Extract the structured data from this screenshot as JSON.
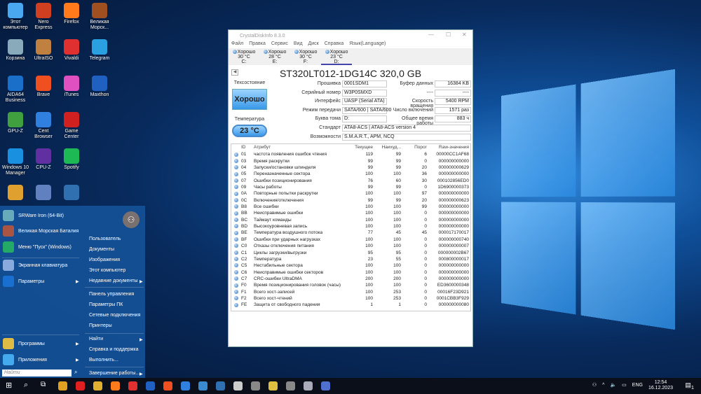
{
  "desktop": {
    "icons": [
      {
        "label": "Этот компьютер",
        "color": "#4aa8f0"
      },
      {
        "label": "Nero Express",
        "color": "#d04020"
      },
      {
        "label": "Firefox",
        "color": "#ff7a1a"
      },
      {
        "label": "Великая Морск...",
        "color": "#a05020"
      },
      {
        "label": "Корзина",
        "color": "#8ab"
      },
      {
        "label": "UltraISO",
        "color": "#c08040"
      },
      {
        "label": "Vivaldi",
        "color": "#e03030"
      },
      {
        "label": "Telegram",
        "color": "#2aa0e0"
      },
      {
        "label": "AIDA64 Business",
        "color": "#1a70c8"
      },
      {
        "label": "Brave",
        "color": "#f05020"
      },
      {
        "label": "iTunes",
        "color": "#e050c0"
      },
      {
        "label": "Maxthon",
        "color": "#2060c0"
      },
      {
        "label": "GPU-Z",
        "color": "#40a040"
      },
      {
        "label": "Cent Browser",
        "color": "#3080e0"
      },
      {
        "label": "Game Center",
        "color": "#d02020"
      },
      null,
      {
        "label": "Windows 10 Manager",
        "color": "#1a90e0"
      },
      {
        "label": "CPU-Z",
        "color": "#6030a0"
      },
      {
        "label": "Spotify",
        "color": "#1db954"
      },
      null,
      {
        "label": "",
        "color": "#e0a030"
      },
      {
        "label": "",
        "color": "#6080c0"
      },
      {
        "label": "",
        "color": "#3070b0"
      },
      null
    ]
  },
  "window": {
    "title": "CrystalDiskInfo 8.3.0",
    "menu": [
      "Файл",
      "Правка",
      "Сервис",
      "Вид",
      "Диск",
      "Справка",
      "Язык(Language)"
    ],
    "drives": [
      {
        "status": "Хорошо",
        "temp": "30 °C",
        "letter": "C:"
      },
      {
        "status": "Хорошо",
        "temp": "28 °C",
        "letter": "E:"
      },
      {
        "status": "Хорошо",
        "temp": "30 °C",
        "letter": "F:"
      },
      {
        "status": "Хорошо",
        "temp": "23 °C",
        "letter": "D:"
      }
    ],
    "model": "ST320LT012-1DG14C 320,0 GB",
    "health_label": "Техсостояние",
    "health": "Хорошо",
    "temp_label": "Температура",
    "temp": "23 °C",
    "fields": [
      {
        "label": "Прошивка",
        "value": "0001SDM1"
      },
      {
        "label": "Серийный номер",
        "value": "W3P0SMXD"
      },
      {
        "label": "Интерфейс",
        "value": "UASP (Serial ATA)"
      },
      {
        "label": "Режим передачи",
        "value": "SATA/600 | SATA/600"
      },
      {
        "label": "Буква тома",
        "value": "D:"
      }
    ],
    "rfields": [
      {
        "label": "Буфер данных",
        "value": "16384 KB"
      },
      {
        "label": "----",
        "value": "----"
      },
      {
        "label": "Скорость вращения",
        "value": "5400 RPM"
      },
      {
        "label": "Число включений",
        "value": "1571 раз"
      },
      {
        "label": "Общее время работы",
        "value": "883 ч"
      }
    ],
    "wide": [
      {
        "label": "Стандарт",
        "value": "ATA8-ACS | ATA8-ACS version 4"
      },
      {
        "label": "Возможности",
        "value": "S.M.A.R.T., APM, NCQ"
      }
    ],
    "columns": [
      "",
      "ID",
      "Атрибут",
      "Текущее",
      "Наихуд...",
      "Порог",
      "Raw-значения"
    ],
    "rows": [
      [
        "01",
        "частота появления ошибок чтения",
        "119",
        "99",
        "6",
        "00000CC1AF68"
      ],
      [
        "03",
        "Время раскрутки",
        "99",
        "99",
        "0",
        "000000000000"
      ],
      [
        "04",
        "Запуски/остановки шпинделя",
        "99",
        "99",
        "20",
        "000000000629"
      ],
      [
        "05",
        "Переназначенные сектора",
        "100",
        "100",
        "36",
        "000000000000"
      ],
      [
        "07",
        "Ошибки позиционирования",
        "76",
        "60",
        "30",
        "000102856ED0"
      ],
      [
        "09",
        "Часы работы",
        "99",
        "99",
        "0",
        "1D6900000373"
      ],
      [
        "0A",
        "Повторные попытки раскрутки",
        "100",
        "100",
        "97",
        "000000000000"
      ],
      [
        "0C",
        "Включения/отключения",
        "99",
        "99",
        "20",
        "000000000623"
      ],
      [
        "B8",
        "Все ошибки",
        "100",
        "100",
        "99",
        "000000000000"
      ],
      [
        "BB",
        "Неисправимые ошибки",
        "100",
        "100",
        "0",
        "000000000000"
      ],
      [
        "BC",
        "Таймаут команды",
        "100",
        "100",
        "0",
        "000000000000"
      ],
      [
        "BD",
        "Высокоуровневая запись",
        "100",
        "100",
        "0",
        "000000000000"
      ],
      [
        "BE",
        "Температура воздушного потока",
        "77",
        "45",
        "45",
        "000017170017"
      ],
      [
        "BF",
        "Ошибки при ударных нагрузках",
        "100",
        "100",
        "0",
        "000000000740"
      ],
      [
        "C0",
        "Отказы отключения питания",
        "100",
        "100",
        "0",
        "000000000007"
      ],
      [
        "C1",
        "Циклы загрузки/выгрузки",
        "95",
        "95",
        "0",
        "000000002B67"
      ],
      [
        "C2",
        "Температура",
        "23",
        "55",
        "0",
        "000800000017"
      ],
      [
        "C5",
        "Нестабильные сектора",
        "100",
        "100",
        "0",
        "000000000000"
      ],
      [
        "C6",
        "Неисправимые ошибки секторов",
        "100",
        "100",
        "0",
        "000000000000"
      ],
      [
        "C7",
        "CRC-ошибки UltraDMA",
        "200",
        "200",
        "0",
        "000000000000"
      ],
      [
        "F0",
        "Время позиционирования головок (часы)",
        "100",
        "100",
        "0",
        "ED3600000348"
      ],
      [
        "F1",
        "Всего хост-записей",
        "100",
        "253",
        "0",
        "00016F23D921"
      ],
      [
        "F2",
        "Всего хост-чтений",
        "100",
        "253",
        "0",
        "0001CBB3F929"
      ],
      [
        "FE",
        "Защита от свободного падения",
        "1",
        "1",
        "0",
        "000000000080"
      ]
    ]
  },
  "start": {
    "left": [
      {
        "label": "SRWare Iron (64-Bit)",
        "color": "#6ab"
      },
      {
        "label": "Великая Морская Баталия",
        "color": "#a54"
      },
      {
        "label": "Меню \"Пуск\" (Windows)",
        "color": "#2a6"
      },
      {
        "label": "Экранная клавиатура",
        "color": "#8ad"
      },
      {
        "label": "Параметры",
        "color": "#1a70d0"
      },
      {
        "label": "Программы",
        "color": "#db4"
      },
      {
        "label": "Приложения",
        "color": "#4ae"
      }
    ],
    "right": [
      "Пользователь",
      "Документы",
      "Изображения",
      "Этот компьютер",
      "Недавние документы",
      "Панель управления",
      "Параметры ПК",
      "Сетевые подключения",
      "Принтеры",
      "Найти",
      "Справка и поддержка",
      "Выполнить...",
      "Завершение работы..."
    ],
    "search_placeholder": "Найти"
  },
  "taskbar": {
    "lang": "ENG",
    "time": "12:54",
    "date": "16.12.2023",
    "notif": "1",
    "apps": [
      "#e0a020",
      "#e02020",
      "#e0b030",
      "#ff7a1a",
      "#e03030",
      "#2060c0",
      "#f05020",
      "#3080e0",
      "#3a8ad0",
      "#3070b0",
      "#ccc",
      "#888",
      "#e0c040",
      "#888",
      "#aab",
      "#5070d0"
    ]
  }
}
